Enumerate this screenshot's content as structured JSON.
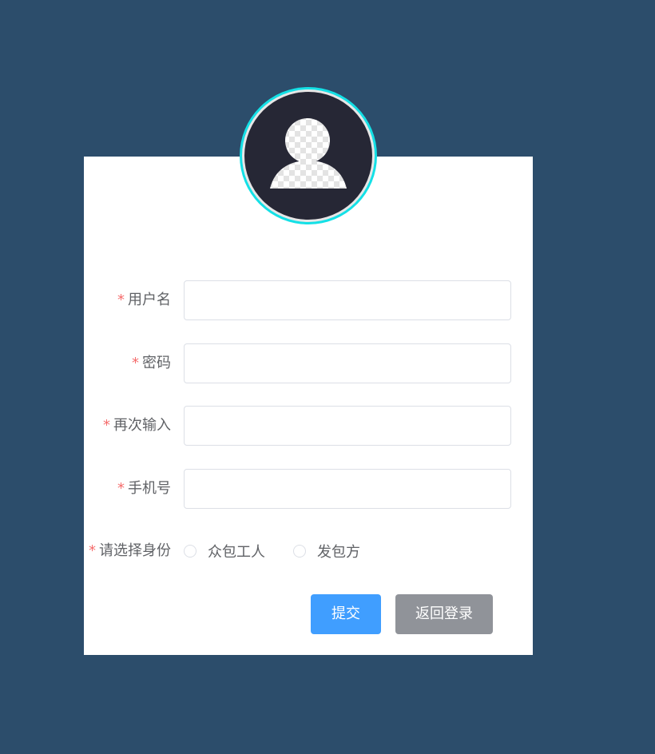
{
  "form": {
    "required_mark": "*",
    "fields": [
      {
        "label": "用户名",
        "value": "",
        "placeholder": ""
      },
      {
        "label": "密码",
        "value": "",
        "placeholder": ""
      },
      {
        "label": "再次输入",
        "value": "",
        "placeholder": ""
      },
      {
        "label": "手机号",
        "value": "",
        "placeholder": ""
      }
    ],
    "identity": {
      "label": "请选择身份",
      "options": [
        {
          "label": "众包工人",
          "selected": false
        },
        {
          "label": "发包方",
          "selected": false
        }
      ]
    },
    "submit_label": "提交",
    "back_label": "返回登录"
  },
  "avatar": {
    "icon": "default-user-avatar-icon"
  },
  "colors": {
    "background": "#2c4d6b",
    "card": "#ffffff",
    "avatar_ring": "#14e0e6",
    "avatar_core": "#262735",
    "required": "#f56c6c",
    "primary_button": "#409eff",
    "info_button": "#909399",
    "label_text": "#606266",
    "input_border": "#dcdfe6"
  }
}
